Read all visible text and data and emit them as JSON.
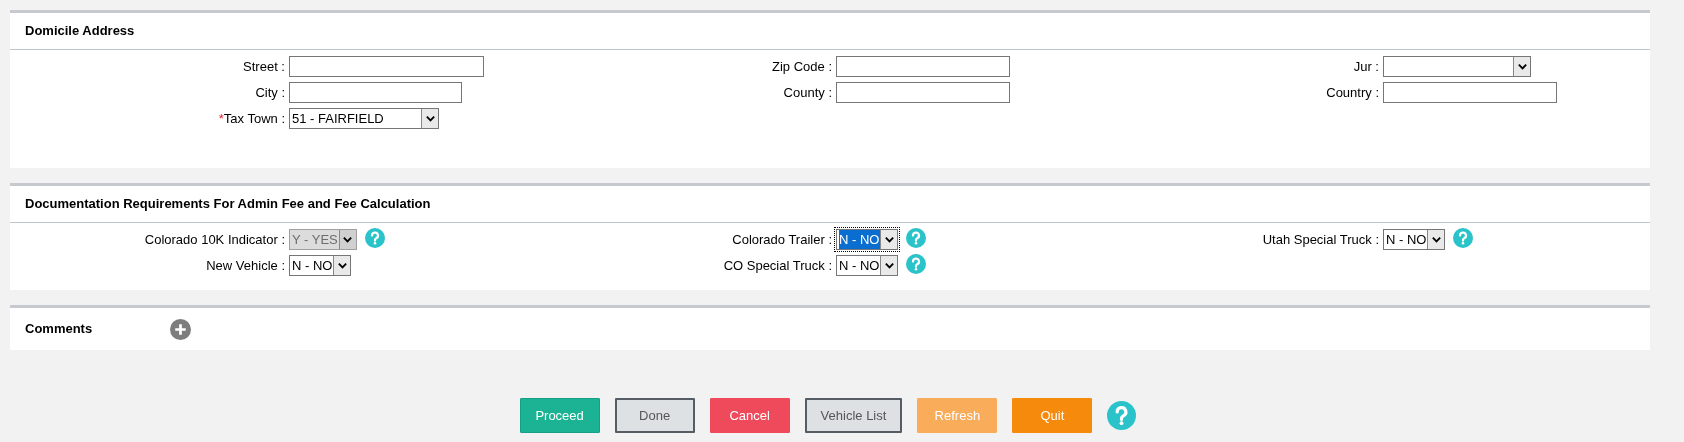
{
  "sections": [
    {
      "title": "Domicile Address",
      "rows": [
        [
          {
            "label": "Street :",
            "kind": "text"
          },
          {
            "label": "Zip Code :",
            "kind": "text"
          },
          {
            "label": "Jur :",
            "kind": "select"
          }
        ],
        [
          {
            "label": "City :",
            "kind": "text"
          },
          {
            "label": "County :",
            "kind": "text"
          },
          {
            "label": "Country :",
            "kind": "text"
          }
        ],
        [
          {
            "label": "Tax Town :",
            "kind": "select",
            "value": "51 - FAIRFIELD",
            "required_mark": "*"
          }
        ]
      ]
    },
    {
      "title": "Documentation Requirements For Admin Fee and Fee Calculation",
      "rows": [
        [
          {
            "label": "Colorado 10K Indicator :",
            "kind": "select",
            "value": "Y - YES",
            "disabled": true,
            "help": true
          },
          {
            "label": "Colorado Trailer :",
            "kind": "select",
            "value": "N - NO",
            "focused": true,
            "help": true
          },
          {
            "label": "Utah Special Truck :",
            "kind": "select",
            "value": "N - NO",
            "help": true
          }
        ],
        [
          {
            "label": "New Vehicle :",
            "kind": "select",
            "value": "N - NO"
          },
          {
            "label": "CO Special Truck :",
            "kind": "select",
            "value": "N - NO",
            "help": true
          }
        ]
      ]
    }
  ],
  "comments": {
    "title": "Comments",
    "add_button": true
  },
  "buttons": [
    {
      "label": "Proceed",
      "kind": "success"
    },
    {
      "label": "Done",
      "kind": "neutral"
    },
    {
      "label": "Cancel",
      "kind": "danger"
    },
    {
      "label": "Vehicle List",
      "kind": "neutral"
    },
    {
      "label": "Refresh",
      "kind": "soft"
    },
    {
      "label": "Quit",
      "kind": "warning"
    }
  ],
  "footer_help": true
}
